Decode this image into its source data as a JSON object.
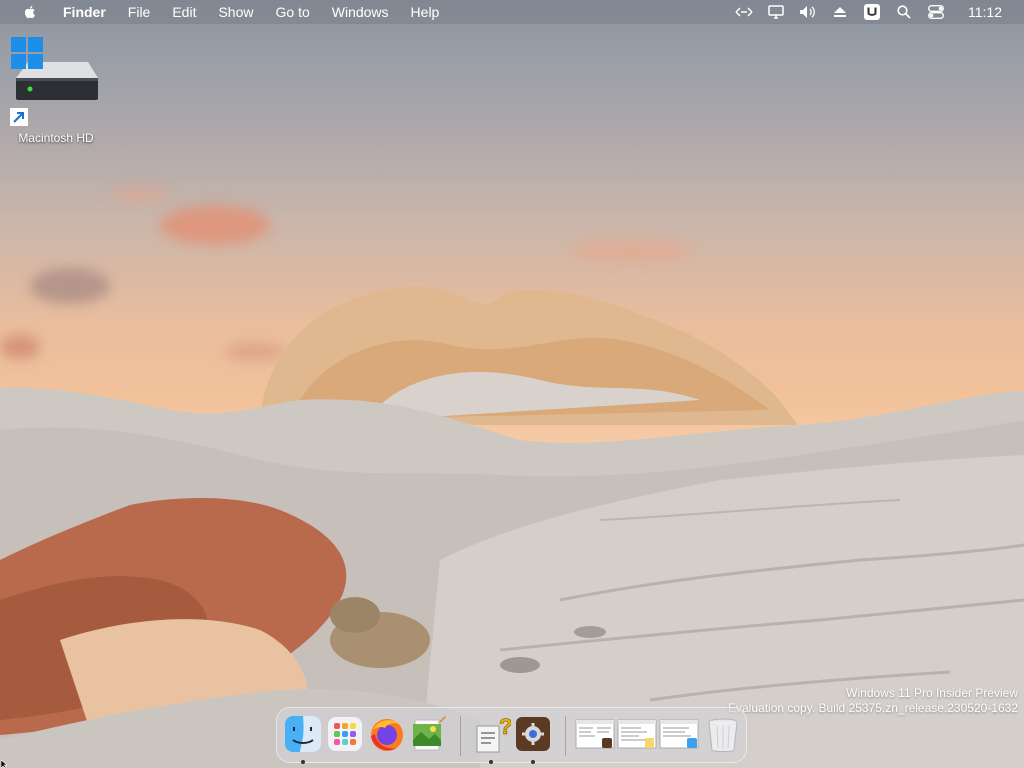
{
  "menubar": {
    "apple_icon": "apple-logo-icon",
    "items": [
      {
        "label": "Finder",
        "bold": true
      },
      {
        "label": "File"
      },
      {
        "label": "Edit"
      },
      {
        "label": "Show"
      },
      {
        "label": "Go to"
      },
      {
        "label": "Windows"
      },
      {
        "label": "Help"
      }
    ],
    "status_icons": [
      "network-arrows-icon",
      "display-icon",
      "volume-icon",
      "eject-icon",
      "u-app-icon",
      "search-icon",
      "control-center-icon"
    ],
    "clock": "11:12"
  },
  "desktop": {
    "icons": [
      {
        "label": "Macintosh HD",
        "icon": "hard-drive-icon",
        "badges": [
          "windows-logo-icon",
          "shortcut-arrow-icon"
        ]
      }
    ]
  },
  "watermark": {
    "line1": "Windows 11 Pro Insider Preview",
    "line2": "Evaluation copy. Build 25375.zn_release.230520-1632"
  },
  "dock": {
    "apps": [
      {
        "name": "finder-icon",
        "running": true
      },
      {
        "name": "launchpad-icon",
        "running": false
      },
      {
        "name": "firefox-icon",
        "running": false
      },
      {
        "name": "preview-icon",
        "running": false
      },
      {
        "name": "help-script-icon",
        "running": true
      },
      {
        "name": "settings-app-icon",
        "running": true
      }
    ],
    "windows": [
      "window-thumbnail-icon",
      "window-thumbnail-icon",
      "window-thumbnail-icon"
    ],
    "trash": "trash-icon"
  },
  "colors": {
    "menubar": "#787d87",
    "sky_top": "#8d96a2",
    "sky_horizon": "#f6ceaa",
    "rock": "#cfc9c4"
  }
}
